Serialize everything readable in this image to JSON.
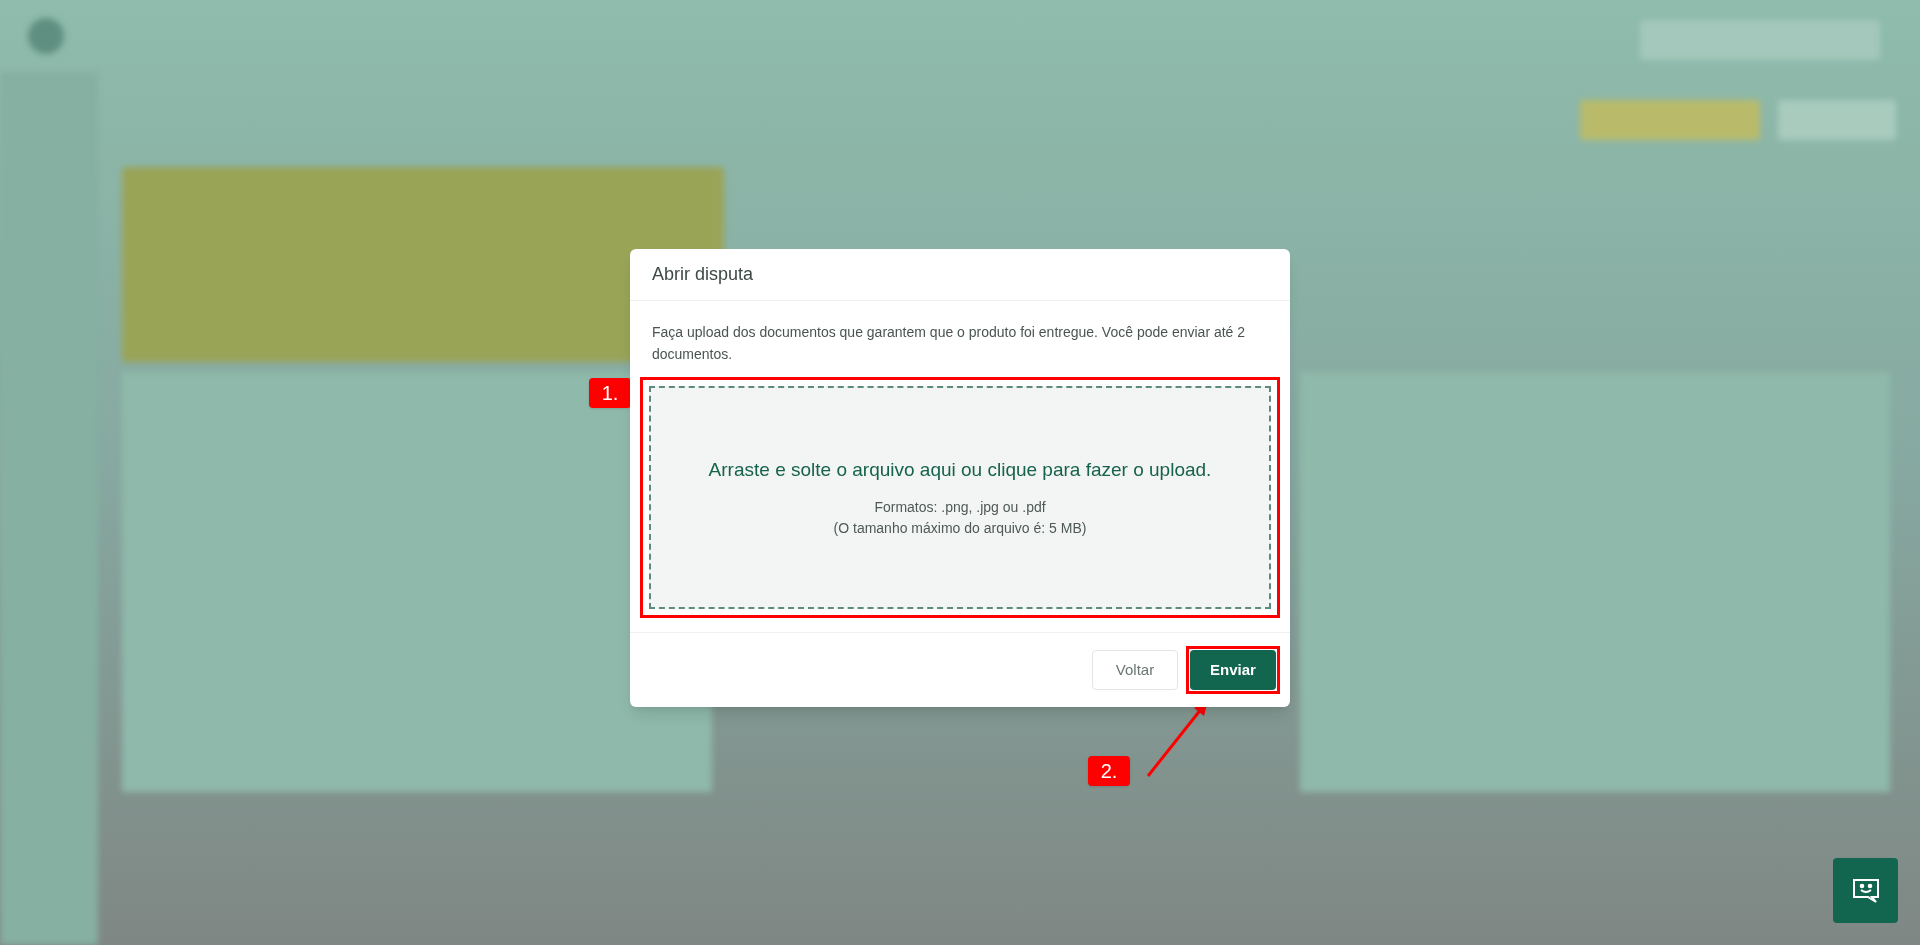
{
  "dialog": {
    "title": "Abrir disputa",
    "description": "Faça upload dos documentos que garantem que o produto foi entregue. Você pode enviar até 2 documentos.",
    "dropzone": {
      "prompt": "Arraste e solte o arquivo aqui ou clique para fazer o upload.",
      "formats": "Formatos: .png, .jpg ou .pdf",
      "size_limit": "(O tamanho máximo do arquivo é: 5 MB)"
    },
    "buttons": [
      {
        "label": "Voltar",
        "kind": "secondary"
      },
      {
        "label": "Enviar",
        "kind": "primary"
      }
    ]
  },
  "annotations": [
    {
      "label": "1."
    },
    {
      "label": "2."
    }
  ]
}
